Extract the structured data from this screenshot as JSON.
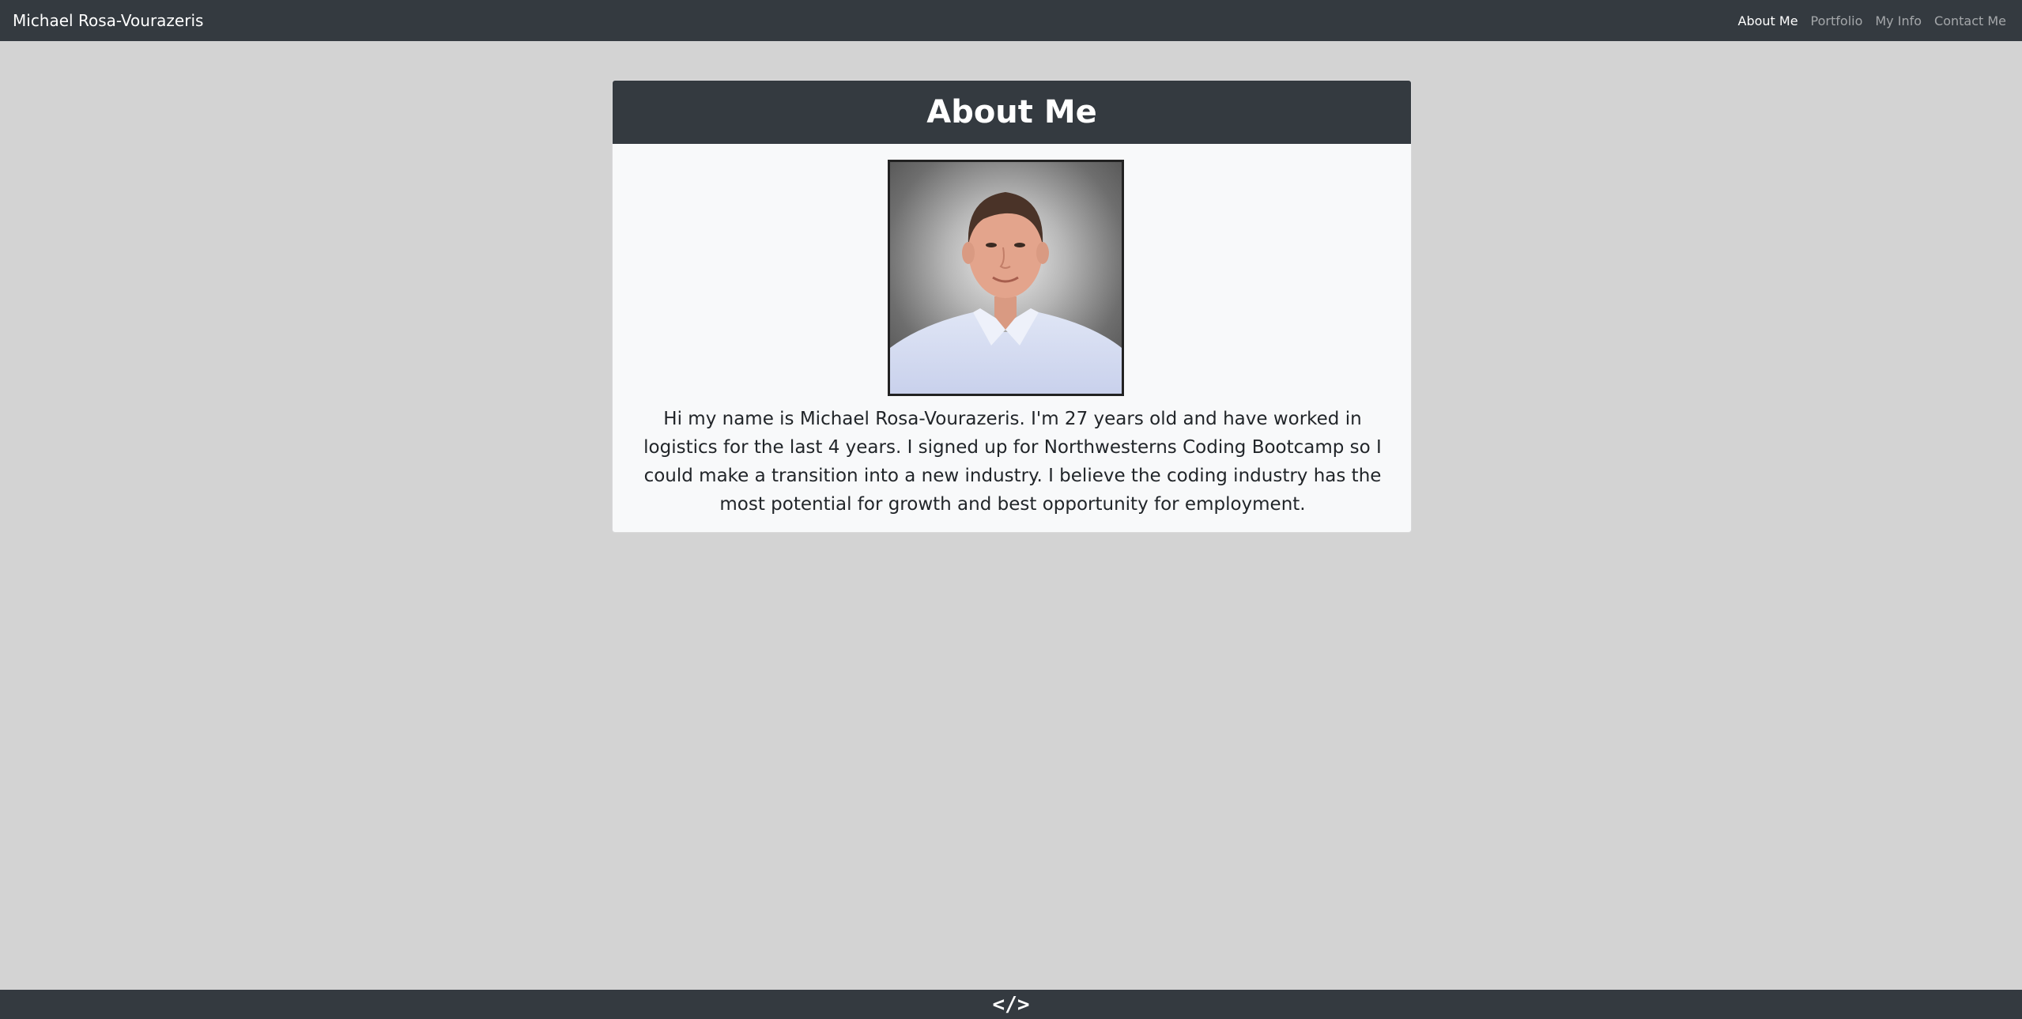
{
  "navbar": {
    "brand": "Michael Rosa-Vourazeris",
    "links": [
      {
        "label": "About Me",
        "active": true
      },
      {
        "label": "Portfolio",
        "active": false
      },
      {
        "label": "My Info",
        "active": false
      },
      {
        "label": "Contact Me",
        "active": false
      }
    ]
  },
  "about": {
    "title": "About Me",
    "photo_icon": "profile-photo",
    "bio": "Hi my name is Michael Rosa-Vourazeris. I'm 27 years old and have worked in logistics for the last 4 years. I signed up for Northwesterns Coding Bootcamp so I could make a transition into a new industry. I believe the coding industry has the most potential for growth and best opportunity for employment."
  },
  "footer": {
    "icon": "code-icon",
    "glyph": "</>"
  },
  "colors": {
    "navbar_bg": "#343a40",
    "page_bg": "#d3d3d3",
    "card_bg": "#f8f9fa",
    "text": "#212529"
  }
}
